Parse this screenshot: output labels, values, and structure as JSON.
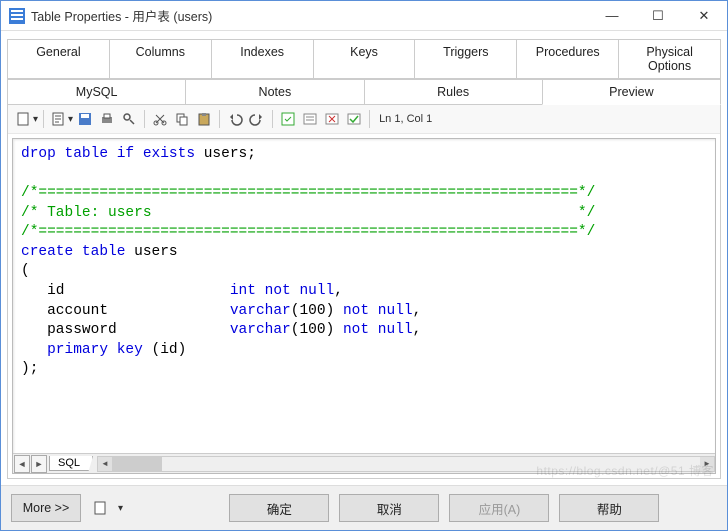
{
  "window": {
    "title": "Table Properties - 用户表 (users)"
  },
  "tabs_row1": [
    "General",
    "Columns",
    "Indexes",
    "Keys",
    "Triggers",
    "Procedures",
    "Physical Options"
  ],
  "tabs_row2": [
    "MySQL",
    "Notes",
    "Rules",
    "Preview"
  ],
  "active_tab": "Preview",
  "toolbar": {
    "cursor_status": "Ln 1, Col 1"
  },
  "code_tokens": [
    [
      {
        "t": "drop table if exists",
        "c": "kw"
      },
      {
        "t": " users;",
        "c": "txt"
      }
    ],
    [
      {
        "t": "",
        "c": "txt"
      }
    ],
    [
      {
        "t": "/*==============================================================*/",
        "c": "cm"
      }
    ],
    [
      {
        "t": "/* Table: users                                                 */",
        "c": "cm"
      }
    ],
    [
      {
        "t": "/*==============================================================*/",
        "c": "cm"
      }
    ],
    [
      {
        "t": "create table",
        "c": "kw"
      },
      {
        "t": " users",
        "c": "txt"
      }
    ],
    [
      {
        "t": "(",
        "c": "txt"
      }
    ],
    [
      {
        "t": "   id                   ",
        "c": "txt"
      },
      {
        "t": "int not null",
        "c": "kw"
      },
      {
        "t": ",",
        "c": "txt"
      }
    ],
    [
      {
        "t": "   account              ",
        "c": "txt"
      },
      {
        "t": "varchar",
        "c": "kw"
      },
      {
        "t": "(100) ",
        "c": "txt"
      },
      {
        "t": "not null",
        "c": "kw"
      },
      {
        "t": ",",
        "c": "txt"
      }
    ],
    [
      {
        "t": "   password             ",
        "c": "txt"
      },
      {
        "t": "varchar",
        "c": "kw"
      },
      {
        "t": "(100) ",
        "c": "txt"
      },
      {
        "t": "not null",
        "c": "kw"
      },
      {
        "t": ",",
        "c": "txt"
      }
    ],
    [
      {
        "t": "   ",
        "c": "txt"
      },
      {
        "t": "primary key",
        "c": "kw"
      },
      {
        "t": " (id)",
        "c": "txt"
      }
    ],
    [
      {
        "t": ");",
        "c": "txt"
      }
    ]
  ],
  "bottom_tab": "SQL",
  "footer": {
    "more": "More >>",
    "ok": "确定",
    "cancel": "取消",
    "apply": "应用(A)",
    "help": "帮助"
  },
  "watermark": "https://blog.csdn.net/@51 博客"
}
